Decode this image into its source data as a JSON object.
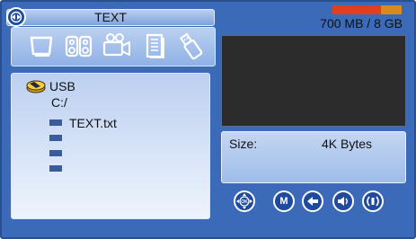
{
  "header": {
    "title": "TEXT",
    "nav_icon": "globe-navigation-icon"
  },
  "storage": {
    "text": "700 MB / 8 GB",
    "used_fraction": 0.7,
    "used_color": "#e04020",
    "free_color": "#d98a1e"
  },
  "categories": [
    {
      "name": "photo-frame",
      "icon": "picture-frame-icon"
    },
    {
      "name": "music",
      "icon": "speaker-icon"
    },
    {
      "name": "video",
      "icon": "movie-camera-icon"
    },
    {
      "name": "text",
      "icon": "document-stack-icon"
    },
    {
      "name": "usb",
      "icon": "usb-drive-icon"
    }
  ],
  "browser": {
    "device_label": "USB",
    "path": "C:/",
    "files": [
      "TEXT.txt",
      "",
      "",
      ""
    ]
  },
  "info": {
    "size_label": "Size:",
    "size_value": "4K Bytes"
  },
  "controls": [
    {
      "icon": "directional-pad-icon",
      "text": ""
    },
    {
      "icon": "menu-button-icon",
      "text": "M"
    },
    {
      "icon": "back-arrow-icon",
      "text": ""
    },
    {
      "icon": "volume-icon",
      "text": ""
    },
    {
      "icon": "audio-icon",
      "text": ""
    }
  ],
  "colors": {
    "background": "#3a6ab8",
    "button": "#1f4a9e"
  }
}
